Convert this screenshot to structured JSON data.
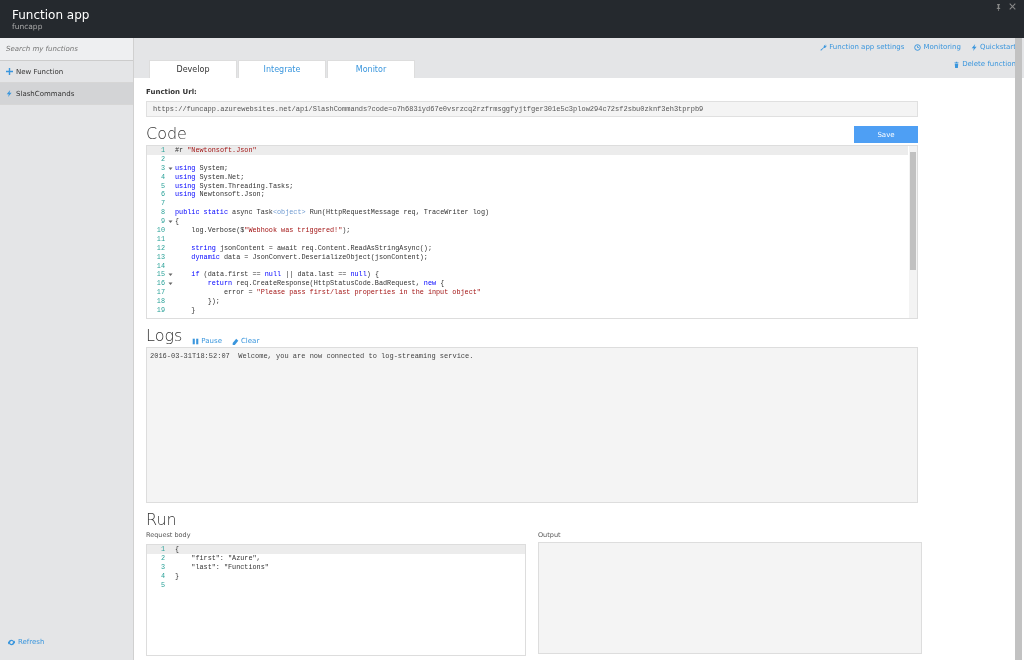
{
  "window": {
    "title": "Function app",
    "subtitle": "funcapp"
  },
  "sidebar": {
    "search": {
      "placeholder": "Search my functions"
    },
    "items": [
      {
        "kind": "new",
        "label": "New Function",
        "selected": false
      },
      {
        "kind": "function",
        "label": "SlashCommands",
        "selected": true
      }
    ],
    "refresh": "Refresh"
  },
  "tabs": [
    {
      "label": "Develop",
      "selected": true
    },
    {
      "label": "Integrate",
      "selected": false
    },
    {
      "label": "Monitor",
      "selected": false
    }
  ],
  "header_links": [
    {
      "kind": "settings",
      "label": "Function app settings"
    },
    {
      "kind": "monitoring",
      "label": "Monitoring"
    },
    {
      "kind": "quickstart",
      "label": "Quickstart"
    }
  ],
  "delete_link": "Delete function",
  "function_url": {
    "label": "Function Url:",
    "value": "https://funcapp.azurewebsites.net/api/SlashCommands?code=o7h683iyd67e0vsrzcq2rzfrmsggfyjtfger301e5c3plow294c72sf2sbu0zknf3eh3tprpb9"
  },
  "code": {
    "title": "Code",
    "save": "Save",
    "lines": [
      {
        "number": "1",
        "fold": false,
        "active": true,
        "tokens": [
          {
            "kind": "plain",
            "text": "#r "
          },
          {
            "kind": "string",
            "text": "\"Newtonsoft.Json\""
          }
        ]
      },
      {
        "number": "2",
        "fold": false,
        "active": false
      },
      {
        "number": "3",
        "fold": true,
        "active": false,
        "tokens": [
          {
            "kind": "keyword",
            "text": "using"
          },
          {
            "kind": "plain",
            "text": " System;"
          }
        ]
      },
      {
        "number": "4",
        "fold": false,
        "active": false,
        "tokens": [
          {
            "kind": "keyword",
            "text": "using"
          },
          {
            "kind": "plain",
            "text": " System.Net;"
          }
        ]
      },
      {
        "number": "5",
        "fold": false,
        "active": false,
        "tokens": [
          {
            "kind": "keyword",
            "text": "using"
          },
          {
            "kind": "plain",
            "text": " System.Threading.Tasks;"
          }
        ]
      },
      {
        "number": "6",
        "fold": false,
        "active": false,
        "tokens": [
          {
            "kind": "keyword",
            "text": "using"
          },
          {
            "kind": "plain",
            "text": " Newtonsoft.Json;"
          }
        ]
      },
      {
        "number": "7",
        "fold": false,
        "active": false
      },
      {
        "number": "8",
        "fold": false,
        "active": false,
        "tokens": [
          {
            "kind": "keyword",
            "text": "public static"
          },
          {
            "kind": "plain",
            "text": " async Task"
          },
          {
            "kind": "type",
            "text": "<object>"
          },
          {
            "kind": "plain",
            "text": " Run(HttpRequestMessage req, TraceWriter log)"
          }
        ]
      },
      {
        "number": "9",
        "fold": true,
        "active": false,
        "tokens": [
          {
            "kind": "plain",
            "text": "{"
          }
        ]
      },
      {
        "number": "10",
        "fold": false,
        "active": false,
        "tokens": [
          {
            "kind": "plain",
            "text": "    log.Verbose($"
          },
          {
            "kind": "string",
            "text": "\"Webhook was triggered!\""
          },
          {
            "kind": "plain",
            "text": ");"
          }
        ]
      },
      {
        "number": "11",
        "fold": false,
        "active": false
      },
      {
        "number": "12",
        "fold": false,
        "active": false,
        "tokens": [
          {
            "kind": "keyword",
            "text": "    string"
          },
          {
            "kind": "plain",
            "text": " jsonContent = await req.Content.ReadAsStringAsync();"
          }
        ]
      },
      {
        "number": "13",
        "fold": false,
        "active": false,
        "tokens": [
          {
            "kind": "keyword",
            "text": "    dynamic"
          },
          {
            "kind": "plain",
            "text": " data = JsonConvert.DeserializeObject(jsonContent);"
          }
        ]
      },
      {
        "number": "14",
        "fold": false,
        "active": false
      },
      {
        "number": "15",
        "fold": true,
        "active": false,
        "tokens": [
          {
            "kind": "keyword",
            "text": "    if"
          },
          {
            "kind": "plain",
            "text": " (data.first == "
          },
          {
            "kind": "keyword",
            "text": "null"
          },
          {
            "kind": "plain",
            "text": " || data.last == "
          },
          {
            "kind": "keyword",
            "text": "null"
          },
          {
            "kind": "plain",
            "text": ") {"
          }
        ]
      },
      {
        "number": "16",
        "fold": true,
        "active": false,
        "tokens": [
          {
            "kind": "keyword",
            "text": "        return"
          },
          {
            "kind": "plain",
            "text": " req.CreateResponse(HttpStatusCode.BadRequest, "
          },
          {
            "kind": "keyword",
            "text": "new"
          },
          {
            "kind": "plain",
            "text": " {"
          }
        ]
      },
      {
        "number": "17",
        "fold": false,
        "active": false,
        "tokens": [
          {
            "kind": "plain",
            "text": "            error = "
          },
          {
            "kind": "string",
            "text": "\"Please pass first/last properties in the input object\""
          }
        ]
      },
      {
        "number": "18",
        "fold": false,
        "active": false,
        "tokens": [
          {
            "kind": "plain",
            "text": "        });"
          }
        ]
      },
      {
        "number": "19",
        "fold": false,
        "active": false,
        "tokens": [
          {
            "kind": "plain",
            "text": "    }"
          }
        ]
      }
    ]
  },
  "logs": {
    "title": "Logs",
    "pause": "Pause",
    "clear": "Clear",
    "entries": [
      {
        "time": "2016-03-31T18:52:07",
        "message": "Welcome, you are now connected to log-streaming service."
      }
    ]
  },
  "run": {
    "title": "Run",
    "request_label": "Request body",
    "output_label": "Output",
    "lines": [
      {
        "number": "1",
        "active": true,
        "text": "{"
      },
      {
        "number": "2",
        "active": false,
        "text": "    \"first\": \"Azure\","
      },
      {
        "number": "3",
        "active": false,
        "text": "    \"last\": \"Functions\""
      },
      {
        "number": "4",
        "active": false,
        "text": "}"
      },
      {
        "number": "5",
        "active": false
      }
    ]
  }
}
